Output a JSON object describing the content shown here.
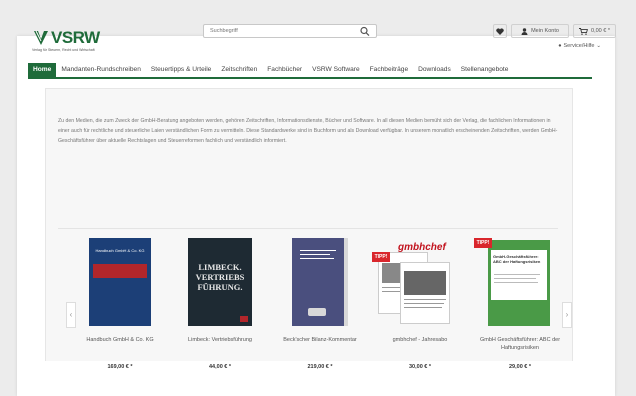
{
  "header": {
    "service_label": "Service/Hilfe",
    "logo_text": "VSRW",
    "logo_subtext": "Verlag für Steuern, Recht und Wirtschaft",
    "search_placeholder": "Suchbegriff",
    "account_label": "Mein Konto",
    "cart_total": "0,00 € *"
  },
  "nav": {
    "items": [
      {
        "label": "Home"
      },
      {
        "label": "Mandanten-Rundschreiben"
      },
      {
        "label": "Steuertipps & Urteile"
      },
      {
        "label": "Zeitschriften"
      },
      {
        "label": "Fachbücher"
      },
      {
        "label": "VSRW Software"
      },
      {
        "label": "Fachbeiträge"
      },
      {
        "label": "Downloads"
      },
      {
        "label": "Stellenangebote"
      }
    ]
  },
  "intro_text": "Zu den Medien, die zum Zweck der GmbH-Beratung angeboten werden, gehören Zeitschriften, Informationsdienste, Bücher und Software. In all diesen Medien bemüht sich der Verlag, die fachlichen Informationen in einer auch für rechtliche und steuerliche Laien verständlichen Form zu vermitteln. Diese Standardwerke sind in Buchform und als Download verfügbar. In unserem monatlich erscheinenden Zeitschriften, werden GmbH-Geschäftsführer über aktuelle Rechtslagen und Steuerreformen fachlich und verständlich informiert.",
  "products": [
    {
      "name": "Handbuch GmbH & Co. KG",
      "price": "169,00 € *",
      "tipp": ""
    },
    {
      "name": "Limbeck: Vertriebsführung",
      "price": "44,00 € *",
      "tipp": ""
    },
    {
      "name": "Beck'scher Bilanz-Kommentar",
      "price": "219,00 € *",
      "tipp": ""
    },
    {
      "name": "gmbhchef - Jahresabo",
      "price": "30,00 € *",
      "tipp": "TIPP!"
    },
    {
      "name": "GmbH Geschäftsführer: ABC der Haftungsrisiken",
      "price": "29,00 € *",
      "tipp": "TIPP!"
    }
  ],
  "covers": {
    "c1_title": "Handbuch GmbH & Co. KG",
    "c2_title": "LIMBECK. VERTRIEBS FÜHRUNG.",
    "c4_title": "gmbhchef",
    "c5_title": "GmbH-Geschäftsführer: ABC der Haftungsrisiken"
  },
  "colors": {
    "brand_green": "#1f6b3a",
    "tipp_red": "#d9262c",
    "cover_navy": "#1c3f77",
    "cover_dark": "#1e2a33",
    "cover_purple": "#4a4f7e"
  },
  "icons": [
    "service-icon",
    "logo-icon",
    "search-icon",
    "heart-icon",
    "user-icon",
    "cart-icon",
    "chevron-left-icon",
    "chevron-right-icon"
  ]
}
